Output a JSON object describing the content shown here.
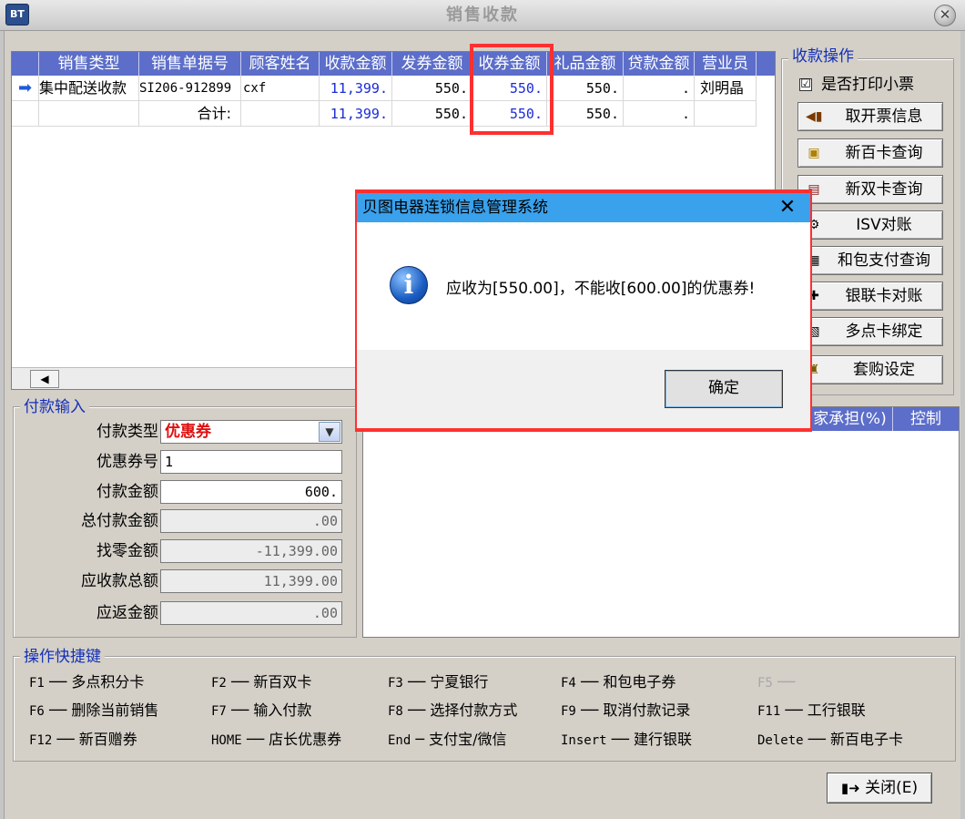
{
  "window": {
    "title": "销售收款",
    "icon_label": "BT"
  },
  "grid": {
    "columns": [
      "销售类型",
      "销售单据号",
      "顾客姓名",
      "收款金额",
      "发券金额",
      "收券金额",
      "礼品金额",
      "贷款金额",
      "营业员"
    ],
    "rows": [
      {
        "type": "集中配送收款",
        "doc_no": "SI206-912899",
        "customer": "cxf",
        "received": "11,399.",
        "issued": "550.",
        "coupon": "550.",
        "gift": "550.",
        "loan": ".",
        "clerk": "刘明晶"
      }
    ],
    "total": {
      "label": "合计:",
      "received": "11,399.",
      "issued": "550.",
      "coupon": "550.",
      "gift": "550.",
      "loan": "."
    }
  },
  "ops": {
    "title": "收款操作",
    "print_ticket_label": "是否打印小票",
    "print_ticket_checked": "☑",
    "buttons": [
      {
        "label": "取开票信息",
        "icon": "invoice-icon"
      },
      {
        "label": "新百卡查询",
        "icon": "card-icon"
      },
      {
        "label": "新双卡查询",
        "icon": "card-search-icon"
      },
      {
        "label": "ISV对账",
        "icon": "reconcile-icon"
      },
      {
        "label": "和包支付查询",
        "icon": "wallet-icon"
      },
      {
        "label": "银联卡对账",
        "icon": "unionpay-icon"
      },
      {
        "label": "多点卡绑定",
        "icon": "link-icon"
      },
      {
        "label": "套购设定",
        "icon": "bundle-icon"
      }
    ]
  },
  "payment": {
    "title": "付款输入",
    "type_label": "付款类型",
    "type_value": "优惠券",
    "coupon_no_label": "优惠券号",
    "coupon_no_value": "1",
    "amount_label": "付款金额",
    "amount_value": "600.",
    "total_paid_label": "总付款金额",
    "total_paid_value": ".00",
    "change_label": "找零金额",
    "change_value": "-11,399.00",
    "due_label": "应收款总额",
    "due_value": "11,399.00",
    "refund_label": "应返金额",
    "refund_value": ".00"
  },
  "right_table": {
    "columns": [
      "家承担(%)",
      "控制"
    ]
  },
  "shortcuts": {
    "title": "操作快捷键",
    "items": [
      {
        "key": "F1",
        "sep": "──",
        "label": "多点积分卡",
        "disabled": false
      },
      {
        "key": "F2",
        "sep": "──",
        "label": "新百双卡",
        "disabled": false
      },
      {
        "key": "F3",
        "sep": "──",
        "label": "宁夏银行",
        "disabled": false
      },
      {
        "key": "F4",
        "sep": "──",
        "label": "和包电子券",
        "disabled": false
      },
      {
        "key": "F5",
        "sep": "──",
        "label": "",
        "disabled": true
      },
      {
        "key": "F6",
        "sep": "──",
        "label": "删除当前销售",
        "disabled": false
      },
      {
        "key": "F7",
        "sep": "──",
        "label": "输入付款",
        "disabled": false
      },
      {
        "key": "F8",
        "sep": "──",
        "label": "选择付款方式",
        "disabled": false
      },
      {
        "key": "F9",
        "sep": "──",
        "label": "取消付款记录",
        "disabled": false
      },
      {
        "key": "F11",
        "sep": "──",
        "label": "工行银联",
        "disabled": false
      },
      {
        "key": "F12",
        "sep": "──",
        "label": "新百赠券",
        "disabled": false
      },
      {
        "key": "HOME",
        "sep": "──",
        "label": "店长优惠券",
        "disabled": false
      },
      {
        "key": "End",
        "sep": "─",
        "label": "支付宝/微信",
        "disabled": false
      },
      {
        "key": "Insert",
        "sep": "──",
        "label": "建行银联",
        "disabled": false
      },
      {
        "key": "Delete",
        "sep": "──",
        "label": "新百电子卡",
        "disabled": false
      }
    ]
  },
  "close_button": {
    "label": "关闭(E)"
  },
  "dialog": {
    "title": "贝图电器连锁信息管理系统",
    "message": "应收为[550.00]，不能收[600.00]的优惠券!",
    "ok_label": "确定",
    "close_glyph": "✕"
  },
  "colors": {
    "header_bg": "#5c6ec9",
    "highlight": "#ff3030",
    "dialog_title_bg": "#3aa1ec",
    "blue_text": "#1b2bd6",
    "red_text": "#e01010"
  }
}
